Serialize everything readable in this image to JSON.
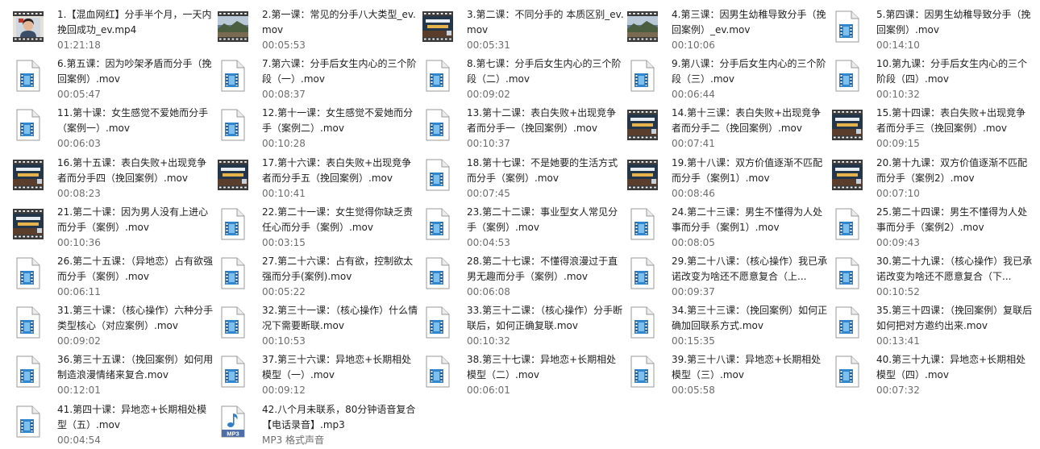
{
  "files": [
    {
      "name": "1.【混血网红】分手半个月，一天内挽回成功_ev.mp4",
      "meta": "01:21:18",
      "icon": "person-video-thumbnail"
    },
    {
      "name": "2.第一课：常见的分手八大类型_ev.mov",
      "meta": "00:05:53",
      "icon": "landscape-video-thumbnail"
    },
    {
      "name": "3.第二课：不同分手的 本质区别_ev.mov",
      "meta": "00:05:31",
      "icon": "title-card-video-thumbnail"
    },
    {
      "name": "4.第三课：因男生幼稚导致分手（挽回案例）_ev.mov",
      "meta": "00:10:06",
      "icon": "landscape-video-thumbnail"
    },
    {
      "name": "5.第四课：因男生幼稚导致分手（挽回案例）.mov",
      "meta": "00:14:10",
      "icon": "mov-file-icon"
    },
    {
      "name": "6.第五课：因为吵架矛盾而分手（挽回案例）.mov",
      "meta": "00:05:47",
      "icon": "mov-file-icon"
    },
    {
      "name": "7.第六课：分手后女生内心的三个阶段（一）.mov",
      "meta": "00:08:37",
      "icon": "mov-file-icon"
    },
    {
      "name": "8.第七课：分手后女生内心的三个阶段（二）.mov",
      "meta": "00:09:02",
      "icon": "mov-file-icon"
    },
    {
      "name": "9.第八课：分手后女生内心的三个阶段（三）.mov",
      "meta": "00:06:44",
      "icon": "mov-file-icon"
    },
    {
      "name": "10.第九课：分手后女生内心的三个阶段（四）.mov",
      "meta": "00:10:32",
      "icon": "mov-file-icon"
    },
    {
      "name": "11.第十课：女生感觉不爱她而分手（案例一）.mov",
      "meta": "00:06:03",
      "icon": "mov-file-icon"
    },
    {
      "name": "12.第十一课：女生感觉不爱她而分手（案例二）.mov",
      "meta": "00:10:28",
      "icon": "mov-file-icon"
    },
    {
      "name": "13.第十二课：表白失败+出现竞争者而分手一（挽回案例）.mov",
      "meta": "00:10:37",
      "icon": "mov-file-icon"
    },
    {
      "name": "14.第十三课：表白失败+出现竞争者而分手二（挽回案例）.mov",
      "meta": "00:07:41",
      "icon": "title-card-video-thumbnail"
    },
    {
      "name": "15.第十四课：表白失败+出现竞争者而分手三（挽回案例）.mov",
      "meta": "00:09:15",
      "icon": "title-card-video-thumbnail"
    },
    {
      "name": "16.第十五课：表白失败+出现竞争者而分手四（挽回案例）.mov",
      "meta": "00:08:23",
      "icon": "title-card-video-thumbnail"
    },
    {
      "name": "17.第十六课：表白失败+出现竞争者而分手五（挽回案例）.mov",
      "meta": "00:10:41",
      "icon": "title-card-video-thumbnail"
    },
    {
      "name": "18.第十七课：不是她要的生活方式而分手（案例）.mov",
      "meta": "00:07:45",
      "icon": "mov-file-icon"
    },
    {
      "name": "19.第十八课：双方价值逐渐不匹配而分手（案例1）.mov",
      "meta": "00:08:46",
      "icon": "title-card-video-thumbnail"
    },
    {
      "name": "20.第十九课：双方价值逐渐不匹配而分手（案例2）.mov",
      "meta": "00:07:10",
      "icon": "title-card-video-thumbnail"
    },
    {
      "name": "21.第二十课：因为男人没有上进心而分手（案例）.mov",
      "meta": "00:10:36",
      "icon": "title-card-video-thumbnail"
    },
    {
      "name": "22.第二十一课：女生觉得你缺乏责任心而分手（案例）.mov",
      "meta": "00:03:15",
      "icon": "mov-file-icon"
    },
    {
      "name": "23.第二十二课：事业型女人常见分手（案例）.mov",
      "meta": "00:04:53",
      "icon": "mov-file-icon"
    },
    {
      "name": "24.第二十三课：男生不懂得为人处事而分手（案例1）.mov",
      "meta": "00:08:05",
      "icon": "mov-file-icon"
    },
    {
      "name": "25.第二十四课：男生不懂得为人处事而分手（案例2）.mov",
      "meta": "00:09:43",
      "icon": "mov-file-icon"
    },
    {
      "name": "26.第二十五课：（异地恋）占有欲强而分手（案例）.mov",
      "meta": "00:06:11",
      "icon": "mov-file-icon"
    },
    {
      "name": "27.第二十六课：占有欲，控制欲太强而分手(案例).mov",
      "meta": "00:05:22",
      "icon": "mov-file-icon"
    },
    {
      "name": "28.第二十七课：不懂得浪漫过于直男无趣而分手（案例）.mov",
      "meta": "00:06:08",
      "icon": "mov-file-icon"
    },
    {
      "name": "29.第二十八课：（核心操作）我已承诺改变为啥还不愿意复合（上...",
      "meta": "00:09:37",
      "icon": "mov-file-icon"
    },
    {
      "name": "30.第二十九课：（核心操作）我已承诺改变为啥还不愿意复合（下...",
      "meta": "00:10:52",
      "icon": "mov-file-icon"
    },
    {
      "name": "31.第三十课：（核心操作）六种分手类型核心（对应案例）.mov",
      "meta": "00:09:02",
      "icon": "mov-file-icon"
    },
    {
      "name": "32.第三十一课：（核心操作）什么情况下需要断联.mov",
      "meta": "00:10:53",
      "icon": "mov-file-icon"
    },
    {
      "name": "33.第三十二课：（核心操作）分手断联后，如何正确复联.mov",
      "meta": "00:10:32",
      "icon": "mov-file-icon"
    },
    {
      "name": "34.第三十三课：（挽回案例）如何正确加回联系方式.mov",
      "meta": "00:15:35",
      "icon": "mov-file-icon"
    },
    {
      "name": "35.第三十四课：（挽回案例）复联后如何把对方邀约出来.mov",
      "meta": "00:13:41",
      "icon": "mov-file-icon"
    },
    {
      "name": "36.第三十五课：（挽回案例）如何用制造浪漫情绪来复合.mov",
      "meta": "00:12:01",
      "icon": "mov-file-icon"
    },
    {
      "name": "37.第三十六课：异地恋+长期相处模型（一）.mov",
      "meta": "00:09:12",
      "icon": "mov-file-icon"
    },
    {
      "name": "38.第三十七课：异地恋+长期相处模型（二）.mov",
      "meta": "00:06:01",
      "icon": "mov-file-icon"
    },
    {
      "name": "39.第三十八课：异地恋+长期相处模型（三）.mov",
      "meta": "00:05:58",
      "icon": "mov-file-icon"
    },
    {
      "name": "40.第三十九课：异地恋+长期相处模型（四）.mov",
      "meta": "00:07:32",
      "icon": "mov-file-icon"
    },
    {
      "name": "41.第四十课：异地恋+长期相处模型（五）.mov",
      "meta": "00:04:54",
      "icon": "mov-file-icon"
    },
    {
      "name": "42.八个月未联系，80分钟语音复合【电话录音】.mp3",
      "meta": "MP3 格式声音",
      "icon": "mp3-file-icon",
      "badge": "MP3"
    }
  ],
  "colors": {
    "filename_text": "#222222",
    "meta_text": "#6d6d6d",
    "film_blue": "#3a8fd6",
    "film_strip": "#4a4a4a"
  }
}
